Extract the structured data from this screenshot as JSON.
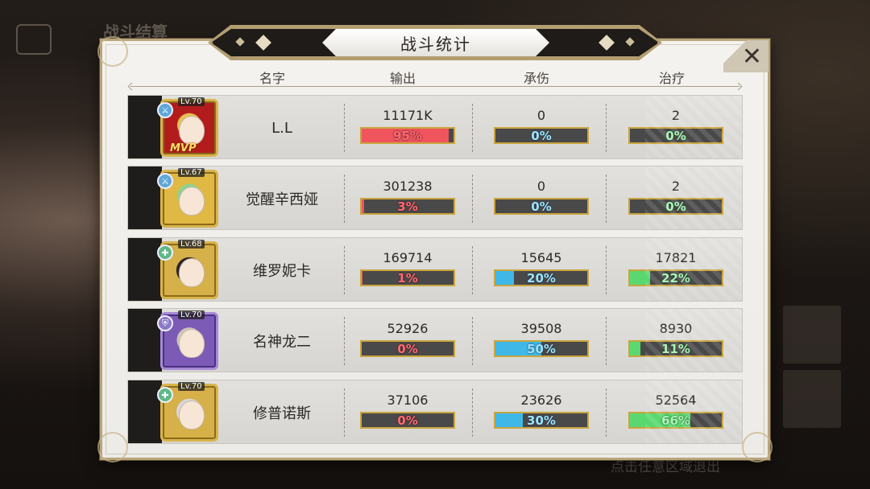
{
  "background": {
    "title": "战斗结算",
    "footer_hint": "点击任意区域退出"
  },
  "panel": {
    "title": "战斗统计",
    "close_symbol": "✕"
  },
  "columns": {
    "name": "名字",
    "output": "输出",
    "damage_taken": "承伤",
    "healing": "治疗"
  },
  "colors": {
    "output_bar": "#f0555e",
    "taken_bar": "#3fb8e8",
    "healing_bar": "#58d86e",
    "bar_border": "#c9a53e"
  },
  "rows": [
    {
      "level": "Lv.70",
      "name": "L.L",
      "mvp": "MVP",
      "role_icon": "sword-icon",
      "output": {
        "value": "11171K",
        "percent": "95%",
        "fraction": 0.95
      },
      "taken": {
        "value": "0",
        "percent": "0%",
        "fraction": 0.0
      },
      "healing": {
        "value": "2",
        "percent": "0%",
        "fraction": 0.0
      }
    },
    {
      "level": "Lv.67",
      "name": "觉醒辛西娅",
      "role_icon": "sword-icon",
      "output": {
        "value": "301238",
        "percent": "3%",
        "fraction": 0.03
      },
      "taken": {
        "value": "0",
        "percent": "0%",
        "fraction": 0.0
      },
      "healing": {
        "value": "2",
        "percent": "0%",
        "fraction": 0.0
      }
    },
    {
      "level": "Lv.68",
      "name": "维罗妮卡",
      "role_icon": "heal-cross-icon",
      "output": {
        "value": "169714",
        "percent": "1%",
        "fraction": 0.01
      },
      "taken": {
        "value": "15645",
        "percent": "20%",
        "fraction": 0.2
      },
      "healing": {
        "value": "17821",
        "percent": "22%",
        "fraction": 0.22
      }
    },
    {
      "level": "Lv.70",
      "name": "名神龙二",
      "role_icon": "shield-icon",
      "output": {
        "value": "52926",
        "percent": "0%",
        "fraction": 0.0
      },
      "taken": {
        "value": "39508",
        "percent": "50%",
        "fraction": 0.5
      },
      "healing": {
        "value": "8930",
        "percent": "11%",
        "fraction": 0.11
      }
    },
    {
      "level": "Lv.70",
      "name": "修普诺斯",
      "role_icon": "heal-cross-icon",
      "output": {
        "value": "37106",
        "percent": "0%",
        "fraction": 0.0
      },
      "taken": {
        "value": "23626",
        "percent": "30%",
        "fraction": 0.3
      },
      "healing": {
        "value": "52564",
        "percent": "66%",
        "fraction": 0.66
      }
    }
  ]
}
